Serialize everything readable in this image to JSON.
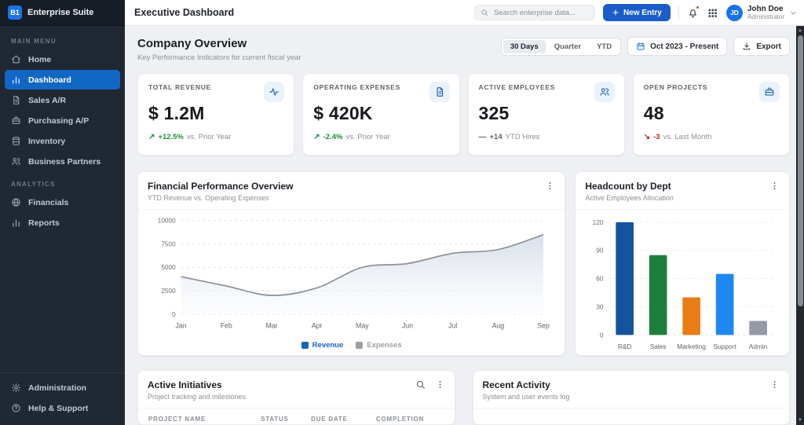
{
  "colors": {
    "accent_blue": "#1a5dc8",
    "avatar_blue": "#1a73e8",
    "sidebar_active_blue": "#1266c4",
    "positive_green": "#1e8e3e",
    "negative_red": "#c5221f",
    "neutral_gray": "#5f6368",
    "muted_text": "#8a9097"
  },
  "sidebar": {
    "logo_text": "B1",
    "brand": "Enterprise Suite",
    "sections": [
      {
        "label": "MAIN MENU",
        "items": [
          {
            "label": "Home",
            "icon": "home-icon",
            "active": false
          },
          {
            "label": "Dashboard",
            "icon": "bar-chart-icon",
            "active": true
          },
          {
            "label": "Sales A/R",
            "icon": "document-icon",
            "active": false
          },
          {
            "label": "Purchasing A/P",
            "icon": "briefcase-icon",
            "active": false
          },
          {
            "label": "Inventory",
            "icon": "database-icon",
            "active": false
          },
          {
            "label": "Business Partners",
            "icon": "people-icon",
            "active": false
          }
        ]
      },
      {
        "label": "ANALYTICS",
        "items": [
          {
            "label": "Financials",
            "icon": "globe-icon",
            "active": false
          },
          {
            "label": "Reports",
            "icon": "bar-chart-icon",
            "active": false
          }
        ]
      }
    ],
    "footer_items": [
      {
        "label": "Administration",
        "icon": "gear-icon"
      },
      {
        "label": "Help & Support",
        "icon": "help-icon"
      }
    ]
  },
  "topbar": {
    "title": "Executive Dashboard",
    "search_placeholder": "Search enterprise data...",
    "new_entry_label": "New Entry",
    "user": {
      "initials": "JD",
      "name": "John Doe",
      "role": "Administrator"
    }
  },
  "page": {
    "title": "Company Overview",
    "subtitle": "Key Performance Indicators for current fiscal year",
    "range_tabs": [
      {
        "label": "30 Days",
        "active": true
      },
      {
        "label": "Quarter",
        "active": false
      },
      {
        "label": "YTD",
        "active": false
      }
    ],
    "date_range": "Oct 2023 - Present",
    "export_label": "Export"
  },
  "kpis": [
    {
      "label": "TOTAL REVENUE",
      "value": "$ 1.2M",
      "icon": "activity-icon",
      "trend_glyph": "↗",
      "trend_value": "+12.5%",
      "trend_color": "green",
      "context": "vs. Prior Year"
    },
    {
      "label": "OPERATING EXPENSES",
      "value": "$ 420K",
      "icon": "document-icon",
      "trend_glyph": "↗",
      "trend_value": "-2.4%",
      "trend_color": "green",
      "context": "vs. Prior Year"
    },
    {
      "label": "ACTIVE EMPLOYEES",
      "value": "325",
      "icon": "people-icon",
      "trend_glyph": "—",
      "trend_value": "+14",
      "trend_color": "gray",
      "context": "YTD Hires"
    },
    {
      "label": "OPEN PROJECTS",
      "value": "48",
      "icon": "briefcase-icon",
      "trend_glyph": "↘",
      "trend_value": "-3",
      "trend_color": "red",
      "context": "vs. Last Month"
    }
  ],
  "chart_data": [
    {
      "type": "area",
      "title": "Financial Performance Overview",
      "subtitle": "YTD Revenue vs. Operating Expenses",
      "x": [
        "Jan",
        "Feb",
        "Mar",
        "Apr",
        "May",
        "Jun",
        "Jul",
        "Aug",
        "Sep"
      ],
      "series": [
        {
          "name": "Revenue",
          "values": [
            4000,
            3000,
            2000,
            2800,
            5000,
            5400,
            6500,
            6900,
            8500
          ],
          "line_color": "#8b939c",
          "fill_top": "#d5dde8",
          "fill_bottom": "#f2f5f9"
        }
      ],
      "ylim": [
        0,
        10000
      ],
      "yticks": [
        0,
        2500,
        5000,
        7500,
        10000
      ],
      "grid": "dashed horizontal",
      "legend_position": "bottom",
      "legend": [
        {
          "label": "Revenue",
          "color": "#1565c0",
          "text_color": "#1a5fc8"
        },
        {
          "label": "Expenses",
          "color": "#9aa0a6",
          "text_color": "#9aa0a6"
        }
      ]
    },
    {
      "type": "bar",
      "title": "Headcount by Dept",
      "subtitle": "Active Employees Allocation",
      "categories": [
        "R&D",
        "Sales",
        "Marketing",
        "Support",
        "Admin"
      ],
      "values": [
        120,
        85,
        40,
        65,
        15
      ],
      "bar_colors": [
        "#15539e",
        "#1e7e3e",
        "#e87d17",
        "#1e88f2",
        "#939aa3"
      ],
      "ylim": [
        0,
        120
      ],
      "yticks": [
        0,
        30,
        60,
        90,
        120
      ],
      "grid": "dashed horizontal",
      "legend_position": "none"
    }
  ],
  "initiatives": {
    "title": "Active Initiatives",
    "subtitle": "Project tracking and milestones",
    "columns": [
      "PROJECT NAME",
      "STATUS",
      "DUE DATE",
      "COMPLETION"
    ]
  },
  "activity": {
    "title": "Recent Activity",
    "subtitle": "System and user events log"
  }
}
